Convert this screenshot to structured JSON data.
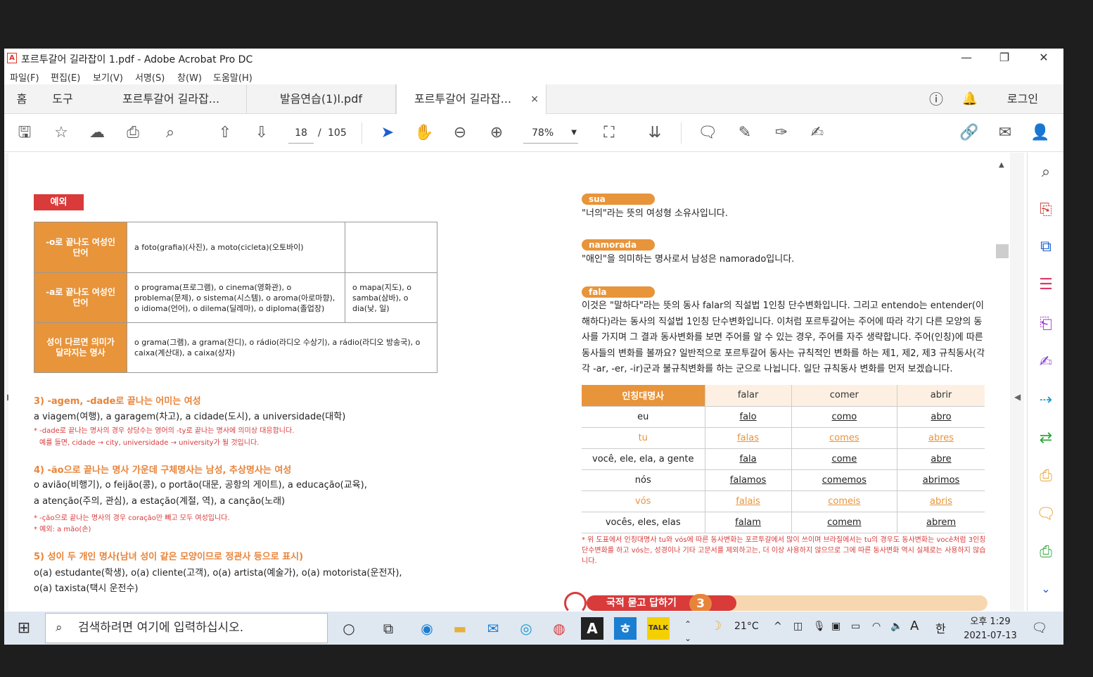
{
  "window": {
    "title": "포르투갈어 길라잡이 1.pdf - Adobe Acrobat Pro DC",
    "app_icon": "acrobat-icon"
  },
  "menu": [
    "파일(F)",
    "편집(E)",
    "보기(V)",
    "서명(S)",
    "창(W)",
    "도움말(H)"
  ],
  "tabs": {
    "home": "홈",
    "tools": "도구",
    "doc1": "포르투갈어 길라잡...",
    "doc2": "발음연습(1)l.pdf",
    "doc3": "포르투갈어 길라잡...",
    "close": "×",
    "login": "로그인"
  },
  "toolbar": {
    "page_current": "18",
    "page_sep": "/",
    "page_total": "105",
    "zoom": "78%"
  },
  "exception": {
    "badge": "예외",
    "rows": [
      {
        "head": "-o로 끝나도 여성인 단어",
        "col1": "a foto(grafia)(사진), a moto(cicleta)(오토바이)",
        "col2": ""
      },
      {
        "head": "-a로 끝나도 여성인 단어",
        "col1": "o programa(프로그램), o cinema(영화관), o problema(문제), o sistema(시스템), o aroma(아로마향), o idioma(언어), o dilema(딜레마), o diploma(졸업장)",
        "col2": "o mapa(지도), o samba(삼바), o dia(낮, 일)"
      },
      {
        "head": "성이 다르면 의미가 달라지는 명사",
        "col1": "o grama(그램), a grama(잔디), o rádio(라디오 수상기), a rádio(라디오 방송국), o caixa(계산대), a caixa(상자)",
        "col2": ""
      }
    ]
  },
  "sections": {
    "s3_title": "3) -agem, -dade로 끝나는 어미는 여성",
    "s3_body": "a viagem(여행), a garagem(차고), a cidade(도시), a universidade(대학)",
    "s3_note1": "* -dade로 끝나는 명사의 경우 상당수는 영어의 -ty로 끝나는 명사에 의미상 대응합니다.",
    "s3_note2": "예를 들면, cidade → city,   universidade → university가 될 것입니다.",
    "s4_title": "4) -ão으로 끝나는 명사 가운데 구체명사는 남성, 추상명사는 여성",
    "s4_body1": "o avião(비행기), o feijão(콩), o portão(대문, 공항의 게이트), a educação(교육),",
    "s4_body2": "a atenção(주의, 관심), a estação(계절, 역), a canção(노래)",
    "s4_note1": "* -ção으로 끝나는 명사의 경우 coração만 빼고 모두 여성입니다.",
    "s4_note2": "* 예외: a mão(손)",
    "s5_title": "5) 성이 두 개인 명사(남녀 성이 같은 모양이므로 정관사 등으로 표시)",
    "s5_body1": "o(a) estudante(학생), o(a) cliente(고객), o(a) artista(예술가), o(a) motorista(운전자),",
    "s5_body2": "o(a) taxista(택시 운전수)"
  },
  "right": {
    "kw1": "sua",
    "kw1_text": "\"너의\"라는 뜻의 여성형 소유사입니다.",
    "kw2": "namorada",
    "kw2_text": "\"애인\"을 의미하는 명사로서 남성은 namorado입니다.",
    "kw3": "fala",
    "kw3_text": "이것은 \"말하다\"라는 뜻의 동사 falar의 직설법 1인칭 단수변화입니다. 그리고 entendo는 entender(이해하다)라는 동사의 직설법 1인칭 단수변화입니다. 이처럼 포르투갈어는 주어에 따라 각기 다른 모양의 동사를 가지며 그 결과 동사변화를 보면 주어를 알 수 있는 경우, 주어를 자주 생략합니다. 주어(인칭)에 따른 동사들의 변화를 볼까요? 일반적으로 포르투갈어 동사는 규칙적인 변화를 하는 제1, 제2, 제3 규칙동사(각각 -ar, -er, -ir)군과 불규칙변화를 하는 군으로 나뉩니다. 일단 규칙동사 변화를 먼저 보겠습니다.",
    "table": {
      "header": [
        "인칭대명사",
        "falar",
        "comer",
        "abrir"
      ],
      "rows": [
        [
          "eu",
          "falo",
          "como",
          "abro"
        ],
        [
          "tu",
          "falas",
          "comes",
          "abres"
        ],
        [
          "você, ele, ela, a gente",
          "fala",
          "come",
          "abre"
        ],
        [
          "nós",
          "falamos",
          "comemos",
          "abrimos"
        ],
        [
          "vós",
          "falais",
          "comeis",
          "abris"
        ],
        [
          "vocês, eles, elas",
          "falam",
          "comem",
          "abrem"
        ]
      ]
    },
    "footnote": "* 위 도표에서 인칭대명사 tu와 vós에 따른 동사변화는 포르투갈에서 많이 쓰이며 브라질에서는 tu의 경우도 동사변화는 você처럼 3인칭 단수변화를 하고 vós는, 성경이나 기타 고문서를 제외하고는, 더 이상 사용하지 않으므로 그에 따른 동사변화 역시 실제로는 사용하지 않습니다.",
    "banner": "국적 묻고 답하기",
    "banner_num": "3"
  },
  "taskbar": {
    "search_placeholder": "검색하려면 여기에 입력하십시오.",
    "weather": "21°C",
    "ime": "A",
    "lang": "한",
    "time": "오후 1:29",
    "date": "2021-07-13"
  }
}
